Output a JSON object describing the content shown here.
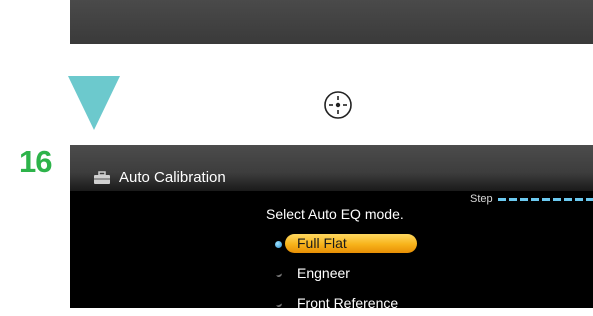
{
  "step_number": "16",
  "screen": {
    "header_title": "Auto Calibration",
    "step_label": "Step",
    "prompt": "Select Auto EQ mode.",
    "options": [
      {
        "label": "Full Flat",
        "selected": true
      },
      {
        "label": "Engneer",
        "selected": false
      },
      {
        "label": "Front Reference",
        "selected": false
      }
    ]
  },
  "colors": {
    "arrow": "#6cc9cd",
    "step_number": "#2db34a",
    "highlight": "#f7b31a",
    "step_dashes": "#6cc9f0"
  },
  "icons": [
    "down-arrow-icon",
    "enter-button-icon",
    "toolbox-icon"
  ]
}
